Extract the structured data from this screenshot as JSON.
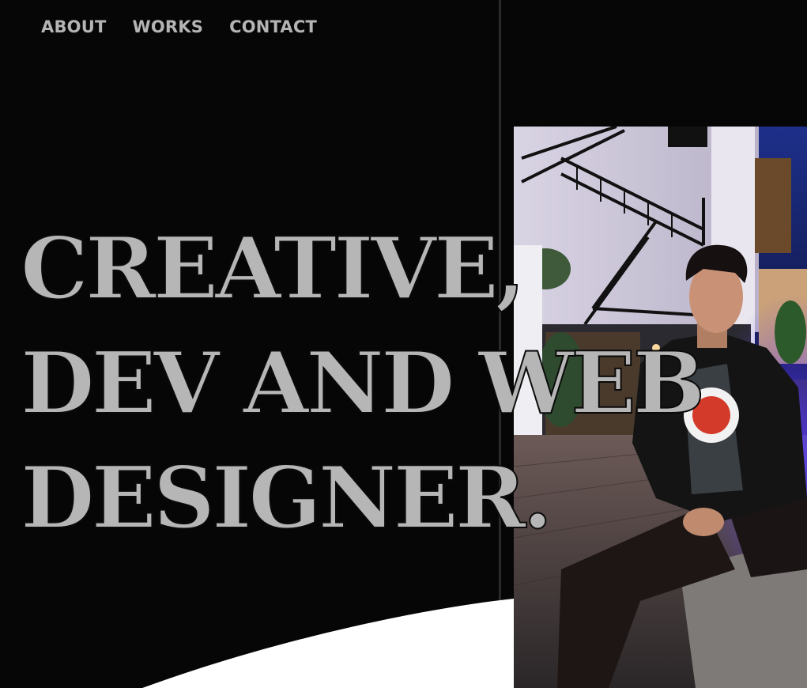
{
  "nav": {
    "items": [
      "ABOUT",
      "WORKS",
      "CONTACT"
    ]
  },
  "hero": {
    "lines": [
      "CREATIVE,",
      "DEV AND WEB",
      "DESIGNER."
    ]
  },
  "colors": {
    "background": "#060606",
    "text": "#b6b6b6",
    "swoosh": "#ffffff"
  }
}
